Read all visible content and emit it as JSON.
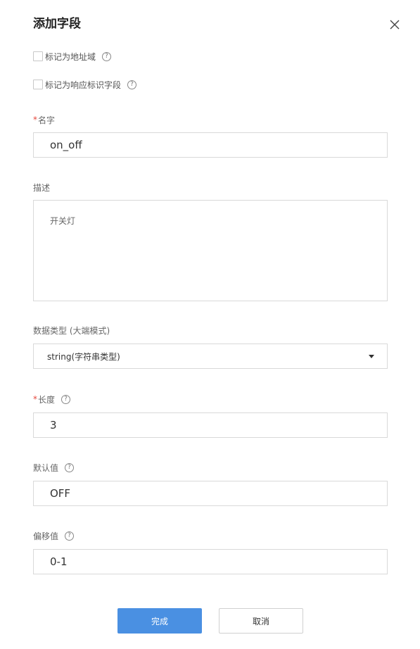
{
  "dialog": {
    "title": "添加字段",
    "close_icon": "close-icon"
  },
  "checks": {
    "address_field_label": "标记为地址域",
    "response_id_label": "标记为响应标识字段"
  },
  "fields": {
    "name": {
      "required_mark": "*",
      "label": "名字",
      "value": "on_off"
    },
    "description": {
      "label": "描述",
      "value": "开关灯"
    },
    "data_type": {
      "label": "数据类型 (大端模式)",
      "value": "string(字符串类型)"
    },
    "length": {
      "required_mark": "*",
      "label": "长度",
      "value": "3"
    },
    "default_value": {
      "label": "默认值",
      "value": "OFF"
    },
    "offset": {
      "label": "偏移值",
      "value": "0-1"
    }
  },
  "help_glyph": "?",
  "buttons": {
    "confirm": "完成",
    "cancel": "取消"
  },
  "colors": {
    "primary": "#4a90e2",
    "required": "#e6483d",
    "border": "#d9d9d9"
  }
}
